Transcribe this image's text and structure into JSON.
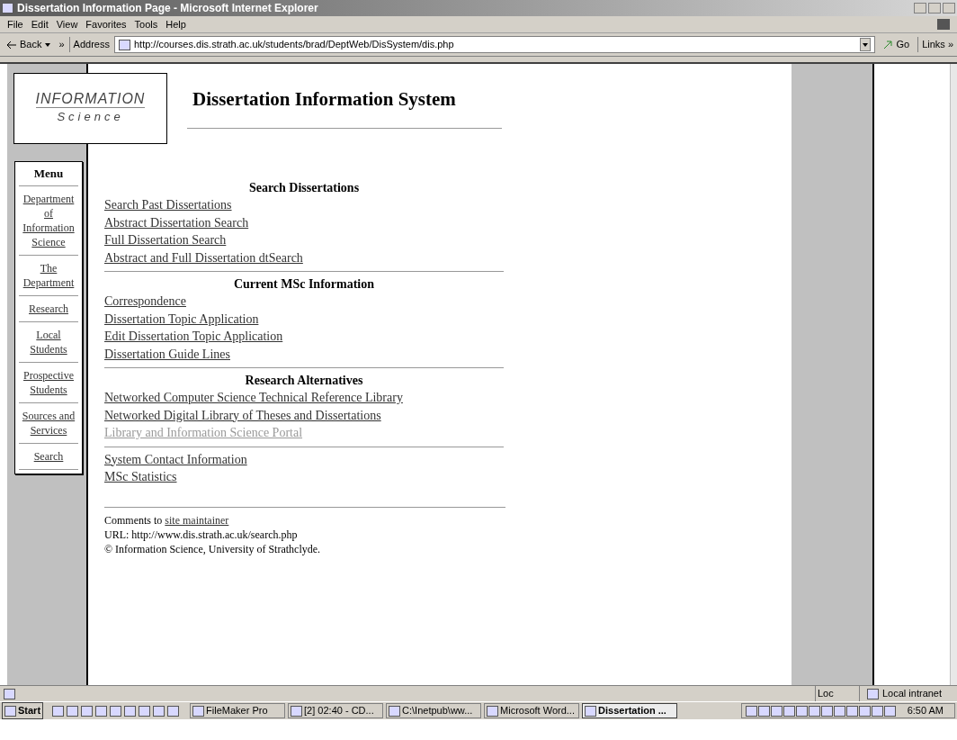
{
  "window": {
    "title": "Dissertation Information Page - Microsoft Internet Explorer"
  },
  "menu_bar": [
    "File",
    "Edit",
    "View",
    "Favorites",
    "Tools",
    "Help"
  ],
  "toolbar": {
    "back": "Back",
    "more": "»",
    "address_label": "Address",
    "address": "http://courses.dis.strath.ac.uk/students/brad/DeptWeb/DisSystem/dis.php",
    "go": "Go",
    "links": "Links »"
  },
  "logo": {
    "line_1": "INFORMATION",
    "line_2": "Science"
  },
  "page_title": "Dissertation Information System",
  "side_menu": {
    "title": "Menu",
    "items": [
      {
        "label": "Department of Information Science"
      },
      {
        "label": "The Department"
      },
      {
        "label": "Research"
      },
      {
        "label": "Local Students"
      },
      {
        "label": "Prospective Students"
      },
      {
        "label": "Sources and Services"
      },
      {
        "label": "Search"
      }
    ]
  },
  "sections": [
    {
      "heading": "Search Dissertations",
      "links": [
        {
          "label": "Search Past Dissertations",
          "visited": false
        },
        {
          "label": "Abstract Dissertation Search",
          "visited": false
        },
        {
          "label": "Full Dissertation Search",
          "visited": false
        },
        {
          "label": "Abstract and Full Dissertation dtSearch",
          "visited": false
        }
      ]
    },
    {
      "heading": "Current MSc Information",
      "links": [
        {
          "label": "Correspondence",
          "visited": false
        },
        {
          "label": "Dissertation Topic Application",
          "visited": false
        },
        {
          "label": "Edit Dissertation Topic Application",
          "visited": false
        },
        {
          "label": "Dissertation Guide Lines",
          "visited": false
        }
      ]
    },
    {
      "heading": "Research Alternatives",
      "links": [
        {
          "label": "Networked Computer Science Technical Reference Library",
          "visited": false
        },
        {
          "label": "Networked Digital Library of Theses and Dissertations",
          "visited": false
        },
        {
          "label": "Library and Information Science Portal",
          "visited": true
        }
      ]
    },
    {
      "links": [
        {
          "label": "System Contact Information",
          "visited": false
        },
        {
          "label": "MSc Statistics",
          "visited": false
        }
      ]
    }
  ],
  "footer": {
    "comments": "Comments to",
    "maintainer_link": "site maintainer",
    "url": "URL: http://www.dis.strath.ac.uk/search.php",
    "copyright": "© Information Science, University of Strathclyde."
  },
  "status_bar": {
    "loc": "Loc",
    "zone": "Local intranet"
  },
  "taskbar": {
    "start": "Start",
    "tasks": [
      {
        "label": "FileMaker Pro",
        "selected": false
      },
      {
        "label": "[2] 02:40 - CD...",
        "selected": false
      },
      {
        "label": "C:\\Inetpub\\ww...",
        "selected": false
      },
      {
        "label": "Microsoft Word...",
        "selected": false
      },
      {
        "label": "Dissertation ...",
        "selected": true
      }
    ],
    "clock": "6:50 AM"
  }
}
